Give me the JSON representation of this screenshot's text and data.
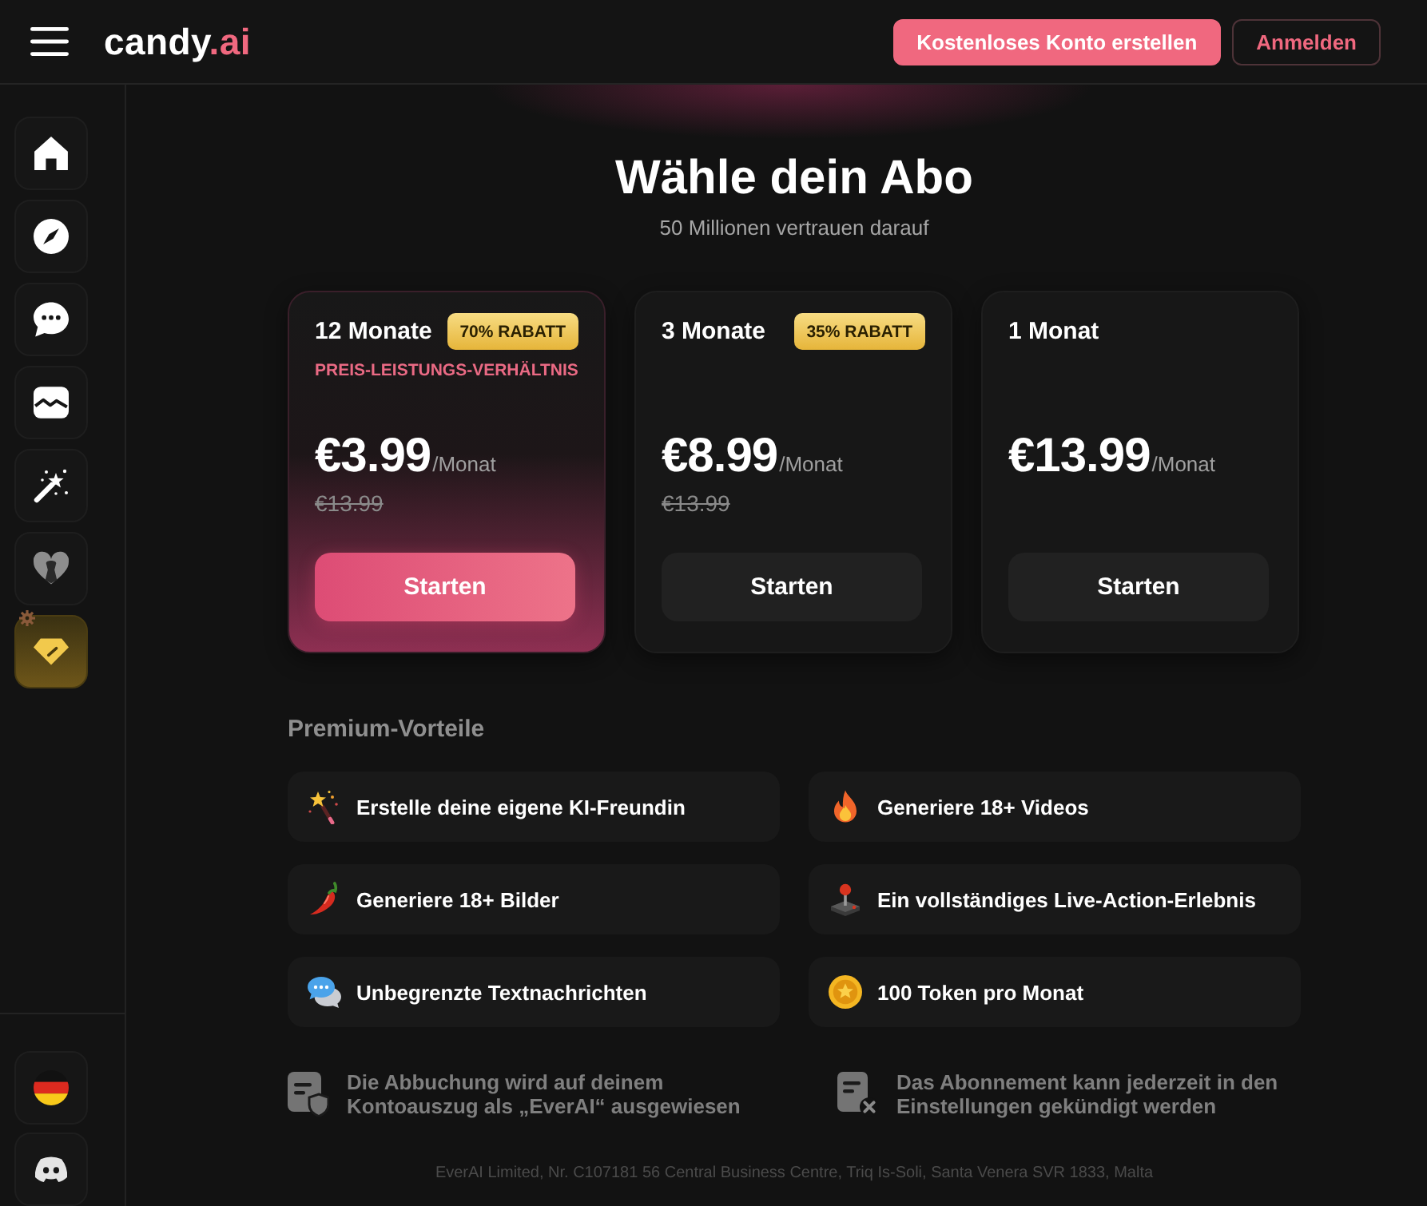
{
  "top_bar": {
    "logo": {
      "name": "candy",
      "suffix": ".ai"
    },
    "buttons": [
      {
        "label": "Kostenloses Konto erstellen",
        "kind": "primary"
      },
      {
        "label": "Anmelden",
        "kind": "outline"
      }
    ]
  },
  "sidebar": {
    "items": [
      {
        "kind": "home",
        "selected": false
      },
      {
        "kind": "discover",
        "selected": false
      },
      {
        "kind": "chat",
        "selected": false
      },
      {
        "kind": "gallery",
        "selected": false
      },
      {
        "kind": "generate",
        "selected": false
      },
      {
        "kind": "companion",
        "selected": false
      },
      {
        "kind": "premium",
        "selected": true
      }
    ],
    "bottom_items": [
      {
        "kind": "language"
      },
      {
        "kind": "community"
      }
    ]
  },
  "hero": {
    "title": "Wähle dein Abo",
    "subtitle": "50 Millionen vertrauen darauf"
  },
  "plans": [
    {
      "duration": "12 Monate",
      "discount": "70% RABATT",
      "tagline": "PREIS-LEISTUNGS-VERHÄLTNIS",
      "price": "€3.99",
      "period": "/Monat",
      "old_price": "€13.99",
      "button": "Starten",
      "selected": true
    },
    {
      "duration": "3 Monate",
      "discount": "35% RABATT",
      "price": "€8.99",
      "period": "/Monat",
      "old_price": "€13.99",
      "button": "Starten",
      "selected": false
    },
    {
      "duration": "1 Monat",
      "price": "€13.99",
      "period": "/Monat",
      "button": "Starten",
      "selected": false
    }
  ],
  "benefits": {
    "title": "Premium-Vorteile",
    "items": [
      {
        "kind": "wand",
        "text": "Erstelle deine eigene KI-Freundin"
      },
      {
        "kind": "flame",
        "text": "Generiere 18+ Videos"
      },
      {
        "kind": "chili",
        "text": "Generiere 18+ Bilder"
      },
      {
        "kind": "joystick",
        "text": "Ein vollständiges Live-Action-Erlebnis"
      },
      {
        "kind": "bubbles",
        "text": "Unbegrenzte Textnachrichten"
      },
      {
        "kind": "coin",
        "text": "100 Token pro Monat"
      }
    ]
  },
  "notes": [
    {
      "kind": "billing",
      "text": "Die Abbuchung wird auf deinem Kontoauszug als „EverAI“ ausgewiesen"
    },
    {
      "kind": "cancel",
      "text": "Das Abonnement kann jederzeit in den Einstellungen gekündigt werden"
    }
  ],
  "footer": "EverAI Limited, Nr. C107181 56 Central Business Centre, Triq Is-Soli, Santa Venera SVR 1833, Malta"
}
